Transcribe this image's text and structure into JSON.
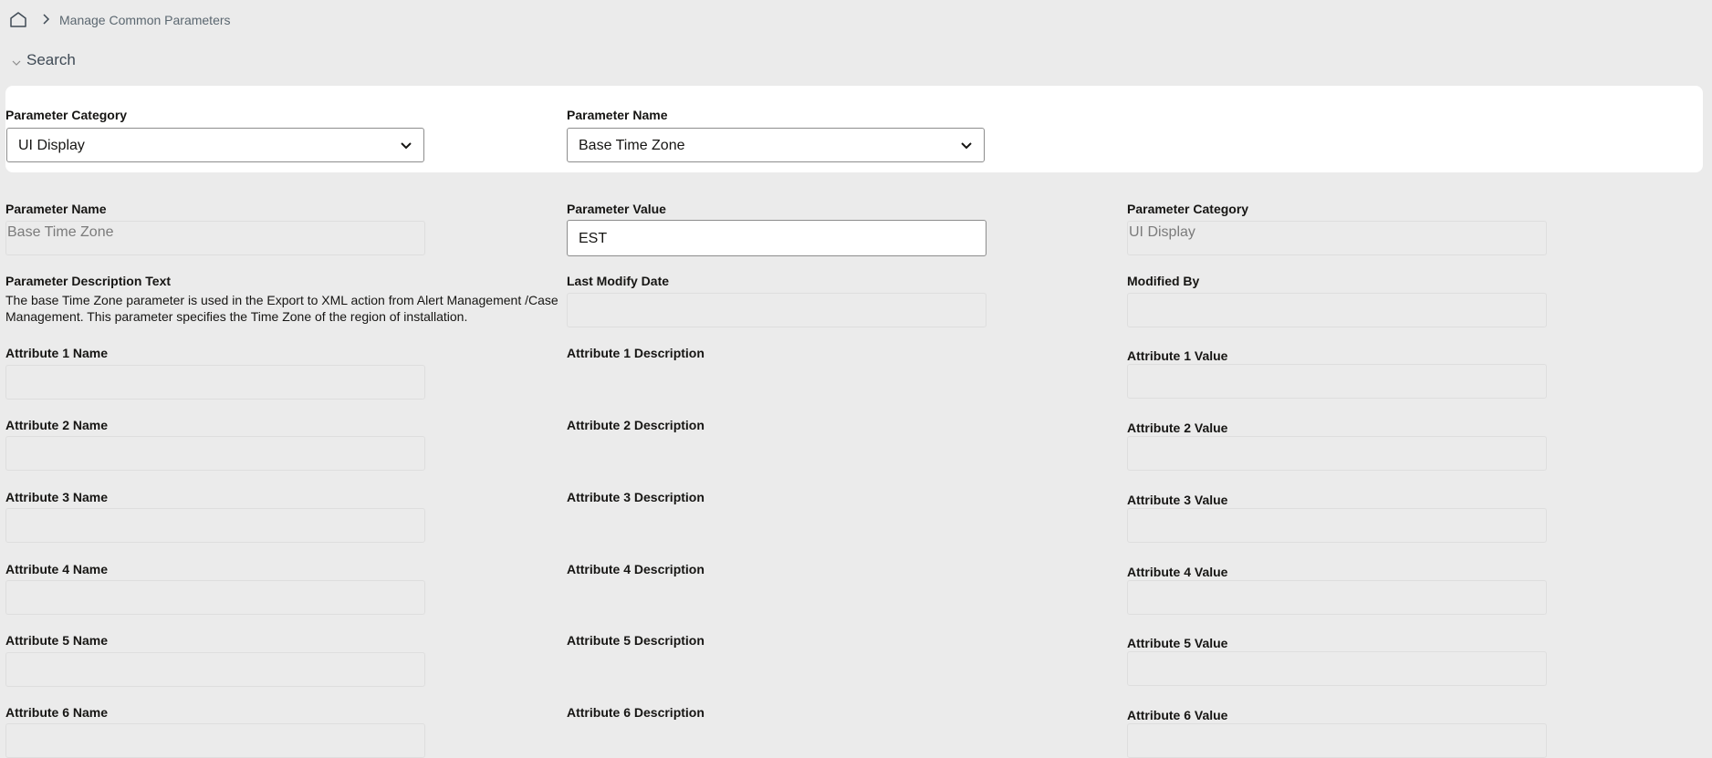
{
  "breadcrumb": {
    "current": "Manage Common Parameters"
  },
  "search": {
    "title": "Search",
    "category_label": "Parameter Category",
    "category_value": "UI Display",
    "name_label": "Parameter Name",
    "name_value": "Base Time Zone"
  },
  "details": {
    "param_name_label": "Parameter Name",
    "param_name_value": "Base Time Zone",
    "param_value_label": "Parameter Value",
    "param_value_value": "EST",
    "param_category_label": "Parameter Category",
    "param_category_value": "UI Display",
    "description_label": "Parameter Description Text",
    "description_value": "The base Time Zone parameter is used in the Export to XML action from Alert Management /Case Management. This parameter specifies the Time Zone of the region of installation.",
    "last_modify_label": "Last Modify Date",
    "modified_by_label": "Modified By"
  },
  "attributes": [
    {
      "name_label": "Attribute 1 Name",
      "desc_label": "Attribute 1 Description",
      "value_label": "Attribute 1 Value"
    },
    {
      "name_label": "Attribute 2 Name",
      "desc_label": "Attribute 2 Description",
      "value_label": "Attribute 2 Value"
    },
    {
      "name_label": "Attribute 3 Name",
      "desc_label": "Attribute 3 Description",
      "value_label": "Attribute 3 Value"
    },
    {
      "name_label": "Attribute 4 Name",
      "desc_label": "Attribute 4 Description",
      "value_label": "Attribute 4 Value"
    },
    {
      "name_label": "Attribute 5 Name",
      "desc_label": "Attribute 5 Description",
      "value_label": "Attribute 5 Value"
    },
    {
      "name_label": "Attribute 6 Name",
      "desc_label": "Attribute 6 Description",
      "value_label": "Attribute 6 Value"
    }
  ]
}
